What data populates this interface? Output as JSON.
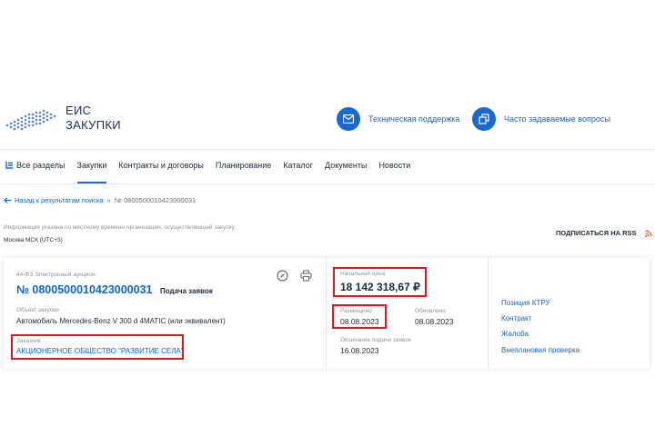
{
  "header": {
    "logo_line1": "ЕИС",
    "logo_line2": "ЗАКУПКИ",
    "support_label": "Техническая поддержка",
    "faq_label": "Часто задаваемые вопросы"
  },
  "nav": {
    "all_sections": "Все разделы",
    "items": [
      "Закупки",
      "Контракты и договоры",
      "Планирование",
      "Каталог",
      "Документы",
      "Новости"
    ],
    "active_index": 0
  },
  "breadcrumb": {
    "back": "Назад к результатам поиска",
    "separator": "»",
    "current": "№ 0800500010423000031"
  },
  "notice": {
    "info": "Информация указана по местному времени организации, осуществляющей закупку",
    "timezone": "Москва МСК (UTC+3)",
    "subscribe_rss": "ПОДПИСАТЬСЯ НА RSS"
  },
  "procurement": {
    "law_type": "44-ФЗ Электронный аукцион",
    "number": "№ 0800500010423000031",
    "status": "Подача заявок",
    "object_label": "Объект закупки",
    "object_value": "Автомобиль Mercedes-Benz V 300 d 4MATIC (или эквивалент)",
    "customer_label": "Заказчик",
    "customer_value": "АКЦИОНЕРНОЕ ОБЩЕСТВО \"РАЗВИТИЕ СЕЛА\"",
    "price_label": "Начальная цена",
    "price_value": "18 142 318,67 ₽",
    "posted_label": "Размещено",
    "posted_value": "08.08.2023",
    "updated_label": "Обновлено",
    "updated_value": "08.08.2023",
    "deadline_label": "Окончание подачи заявок",
    "deadline_value": "16.08.2023"
  },
  "side_links": [
    "Позиция КТРУ",
    "Контракт",
    "Жалоба",
    "Внеплановая проверка"
  ],
  "colors": {
    "accent": "#1a68d6",
    "highlight": "#e8141c",
    "rss": "#e85a1c"
  }
}
